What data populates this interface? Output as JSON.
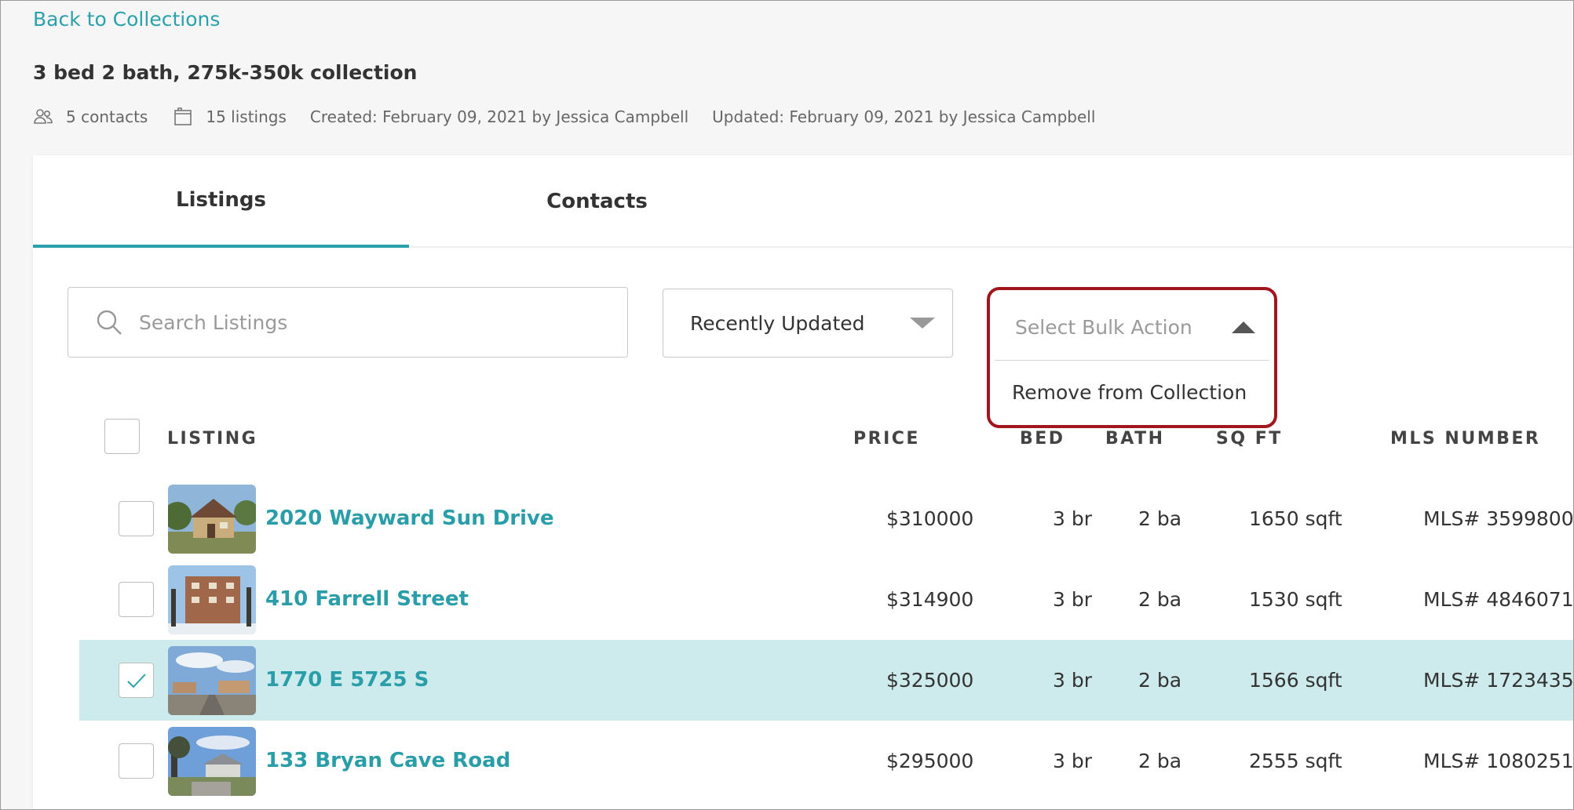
{
  "back_link": "Back to Collections",
  "collection": {
    "title": "3 bed 2 bath, 275k-350k collection",
    "contacts": "5 contacts",
    "listings": "15 listings",
    "created": "Created: February 09, 2021 by Jessica Campbell",
    "updated": "Updated: February 09, 2021 by Jessica Campbell"
  },
  "tabs": [
    {
      "label": "Listings",
      "active": true
    },
    {
      "label": "Contacts",
      "active": false
    }
  ],
  "search": {
    "placeholder": "Search Listings",
    "value": ""
  },
  "sort": {
    "selected": "Recently Updated"
  },
  "bulk_action": {
    "placeholder": "Select Bulk Action",
    "expanded": true,
    "options": [
      "Remove from Collection"
    ]
  },
  "table": {
    "headers": {
      "listing": "LISTING",
      "price": "PRICE",
      "bed": "BED",
      "bath": "BATH",
      "sqft": "SQ FT",
      "mls": "MLS NUMBER"
    },
    "rows": [
      {
        "address": "2020 Wayward Sun Drive",
        "price": "$310000",
        "bed": "3 br",
        "bath": "2 ba",
        "sqft": "1650 sqft",
        "mls": "MLS# 3599800",
        "selected": false
      },
      {
        "address": "410 Farrell Street",
        "price": "$314900",
        "bed": "3 br",
        "bath": "2 ba",
        "sqft": "1530 sqft",
        "mls": "MLS# 4846071",
        "selected": false
      },
      {
        "address": "1770 E 5725 S",
        "price": "$325000",
        "bed": "3 br",
        "bath": "2 ba",
        "sqft": "1566 sqft",
        "mls": "MLS# 1723435",
        "selected": true
      },
      {
        "address": "133 Bryan Cave Road",
        "price": "$295000",
        "bed": "3 br",
        "bath": "2 ba",
        "sqft": "2555 sqft",
        "mls": "MLS# 1080251",
        "selected": false
      }
    ]
  },
  "colors": {
    "accent": "#2aa1ab",
    "highlight": "#a3151c",
    "selected_row": "#cdebec"
  }
}
